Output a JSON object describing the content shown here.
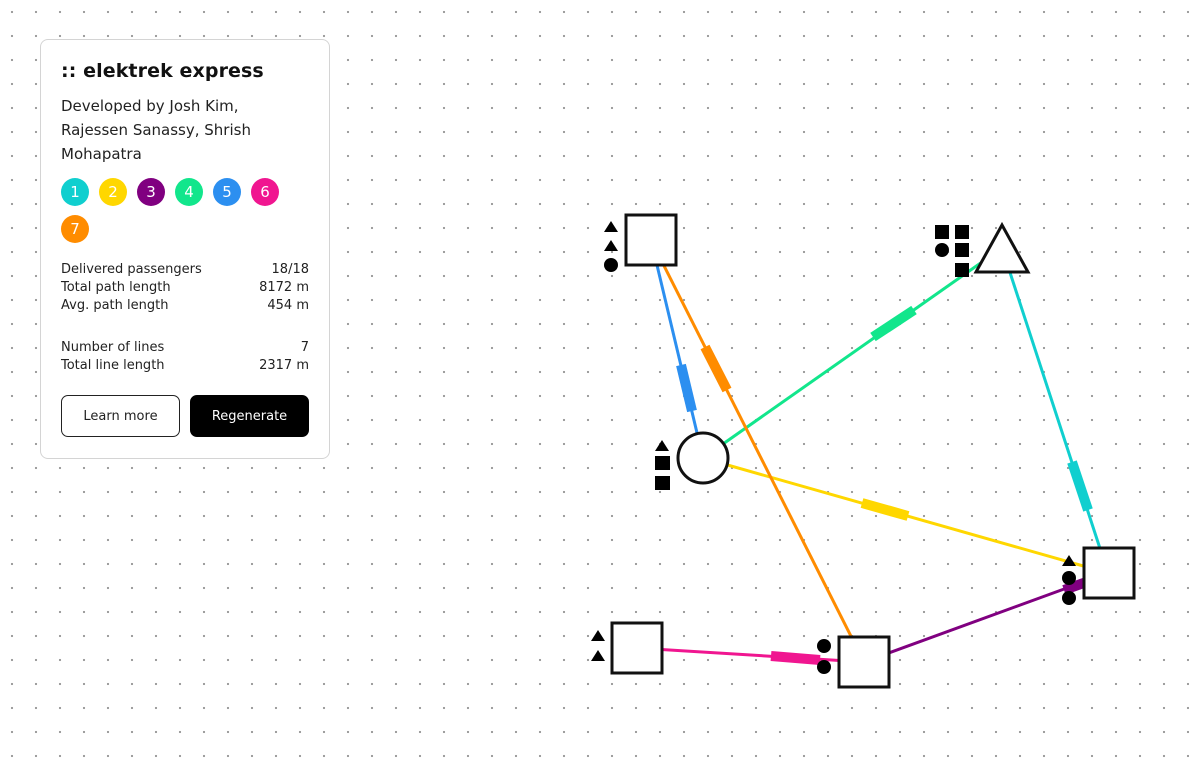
{
  "app": {
    "title": ":: elektrek express",
    "credits": "Developed by Josh Kim, Rajessen Sanassy, Shrish Mohapatra"
  },
  "line_buttons": [
    {
      "label": "1",
      "color": "#10cfcf"
    },
    {
      "label": "2",
      "color": "#ffd700"
    },
    {
      "label": "3",
      "color": "#800080"
    },
    {
      "label": "4",
      "color": "#12e68c"
    },
    {
      "label": "5",
      "color": "#2c8ff0"
    },
    {
      "label": "6",
      "color": "#f01690"
    },
    {
      "label": "7",
      "color": "#ff8c00"
    }
  ],
  "stats": {
    "delivered_label": "Delivered passengers",
    "delivered_value": "18/18",
    "path_length_label": "Total path length",
    "path_length_value": "8172 m",
    "avg_path_label": "Avg. path length",
    "avg_path_value": "454 m",
    "num_lines_label": "Number of lines",
    "num_lines_value": "7",
    "line_length_label": "Total line length",
    "line_length_value": "2317 m"
  },
  "buttons": {
    "learn_more": "Learn more",
    "regenerate": "Regenerate"
  },
  "map": {
    "stations": [
      {
        "id": "A",
        "shape": "square",
        "passengers": [
          "triangle",
          "triangle",
          "circle"
        ]
      },
      {
        "id": "B",
        "shape": "triangle",
        "passengers": [
          "square",
          "square",
          "circle",
          "square",
          "square"
        ]
      },
      {
        "id": "C",
        "shape": "circle",
        "passengers": [
          "triangle",
          "square",
          "square"
        ]
      },
      {
        "id": "D",
        "shape": "square",
        "passengers": [
          "triangle",
          "circle",
          "circle"
        ]
      },
      {
        "id": "E",
        "shape": "square",
        "passengers": [
          "triangle",
          "triangle"
        ]
      },
      {
        "id": "F",
        "shape": "square",
        "passengers": [
          "circle",
          "circle"
        ]
      }
    ],
    "routes": [
      {
        "line": "1",
        "from": "B",
        "to": "D"
      },
      {
        "line": "2",
        "from": "C",
        "to": "D"
      },
      {
        "line": "3",
        "from": "F",
        "to": "D"
      },
      {
        "line": "4",
        "from": "C",
        "to": "B"
      },
      {
        "line": "5",
        "from": "A",
        "to": "C"
      },
      {
        "line": "6",
        "from": "E",
        "to": "F"
      },
      {
        "line": "7",
        "from": "A",
        "to": "F"
      }
    ]
  }
}
